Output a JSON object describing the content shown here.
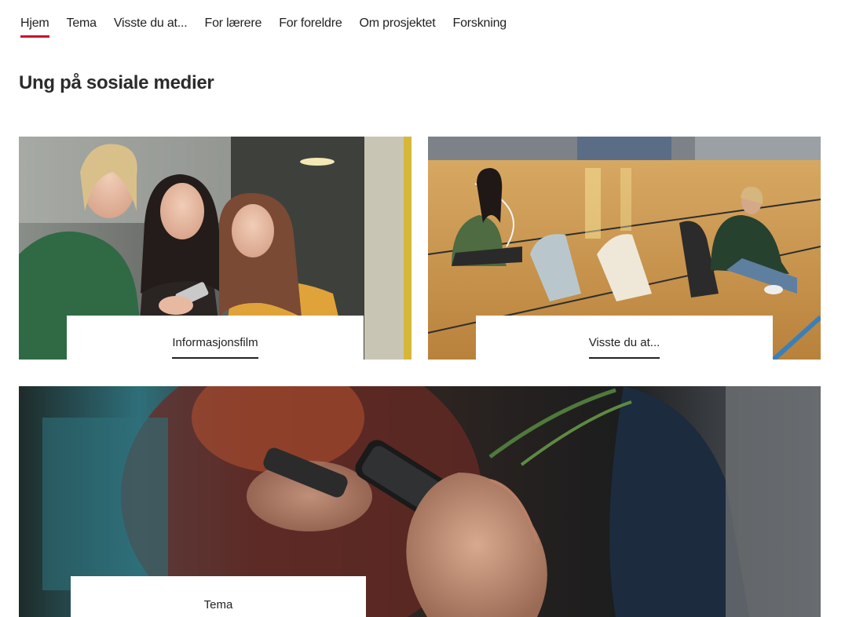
{
  "nav": {
    "items": [
      {
        "label": "Hjem",
        "active": true
      },
      {
        "label": "Tema",
        "active": false
      },
      {
        "label": "Visste du at...",
        "active": false
      },
      {
        "label": "For lærere",
        "active": false
      },
      {
        "label": "For foreldre",
        "active": false
      },
      {
        "label": "Om prosjektet",
        "active": false
      },
      {
        "label": "Forskning",
        "active": false
      }
    ]
  },
  "page": {
    "title": "Ung på sosiale medier"
  },
  "cards": [
    {
      "label": "Informasjonsfilm",
      "image": "three-girls-looking-at-phone-photo"
    },
    {
      "label": "Visste du at...",
      "image": "youths-on-gym-floor-with-phones-photo"
    },
    {
      "label": "Tema",
      "image": "hands-holding-smartphones-photo"
    }
  ],
  "colors": {
    "accent": "#c8102e",
    "text": "#222222",
    "background": "#ffffff"
  }
}
